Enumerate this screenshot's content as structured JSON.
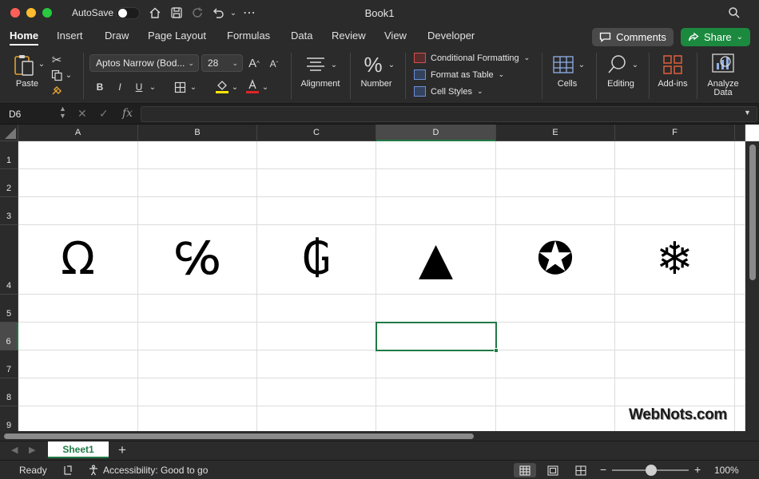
{
  "window": {
    "title": "Book1",
    "autosave_label": "AutoSave",
    "autosave_on": false
  },
  "tabs": [
    {
      "label": "Home",
      "active": true
    },
    {
      "label": "Insert"
    },
    {
      "label": "Draw"
    },
    {
      "label": "Page Layout"
    },
    {
      "label": "Formulas"
    },
    {
      "label": "Data"
    },
    {
      "label": "Review"
    },
    {
      "label": "View"
    },
    {
      "label": "Developer"
    }
  ],
  "actions": {
    "comments_label": "Comments",
    "share_label": "Share"
  },
  "ribbon": {
    "paste_label": "Paste",
    "font_name": "Aptos Narrow (Bod...",
    "font_size": "28",
    "increase_font": "A",
    "decrease_font": "A",
    "bold": "B",
    "italic": "I",
    "underline": "U",
    "alignment_label": "Alignment",
    "number_label": "Number",
    "conditional_formatting": "Conditional Formatting",
    "format_as_table": "Format as Table",
    "cell_styles": "Cell Styles",
    "cells_label": "Cells",
    "editing_label": "Editing",
    "addins_label": "Add-ins",
    "analyze_label_1": "Analyze",
    "analyze_label_2": "Data",
    "highlight_color": "#ffe600",
    "font_color": "#e02424"
  },
  "formula_bar": {
    "name_box": "D6",
    "fx": "fx",
    "formula": ""
  },
  "grid": {
    "columns": [
      "A",
      "B",
      "C",
      "D",
      "E",
      "F"
    ],
    "rows": [
      "1",
      "2",
      "3",
      "4",
      "5",
      "6",
      "7",
      "8",
      "9"
    ],
    "selected_cell": "D6",
    "row4_symbols": [
      "Ω",
      "℅",
      "₲",
      "▲",
      "✪",
      "❄"
    ]
  },
  "sheets": {
    "tabs": [
      "Sheet1"
    ],
    "active": "Sheet1"
  },
  "status": {
    "ready": "Ready",
    "accessibility": "Accessibility: Good to go",
    "zoom": "100%"
  },
  "watermark": "WebNots.com",
  "colors": {
    "accent": "#1f7a45",
    "share_button": "#1b8a3e",
    "chrome": "#2b2b2b"
  }
}
